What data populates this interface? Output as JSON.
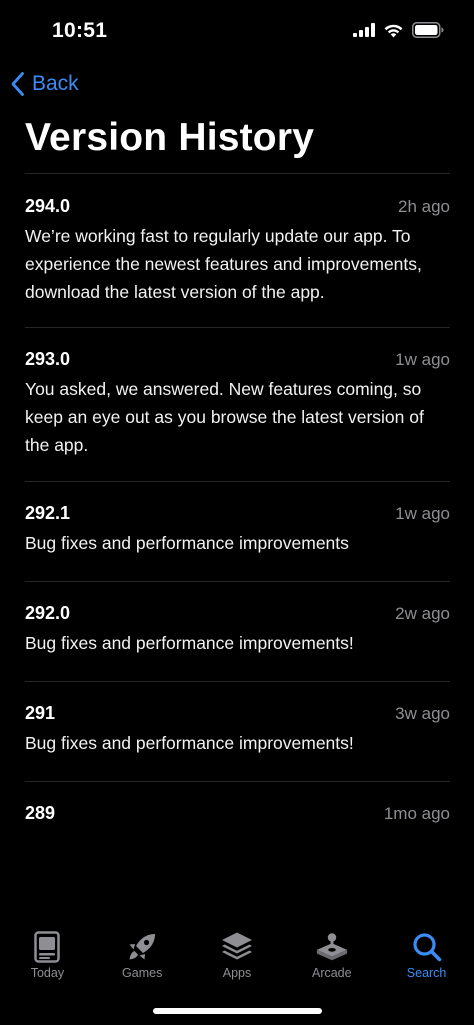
{
  "status_bar": {
    "time": "10:51"
  },
  "nav": {
    "back_label": "Back",
    "title": "Version History"
  },
  "versions": [
    {
      "number": "294.0",
      "date": "2h ago",
      "notes": "We’re working fast to regularly update our app. To experience the newest features and improvements, download the latest version of the app."
    },
    {
      "number": "293.0",
      "date": "1w ago",
      "notes": "You asked, we answered. New features coming, so keep an eye out as you browse the latest version of the app."
    },
    {
      "number": "292.1",
      "date": "1w ago",
      "notes": "Bug fixes and performance improvements"
    },
    {
      "number": "292.0",
      "date": "2w ago",
      "notes": "Bug fixes and performance improvements!"
    },
    {
      "number": "291",
      "date": "3w ago",
      "notes": "Bug fixes and performance improvements!"
    },
    {
      "number": "289",
      "date": "1mo ago",
      "notes": ""
    }
  ],
  "tab_bar": {
    "tabs": [
      {
        "label": "Today",
        "icon": "today-icon",
        "active": false
      },
      {
        "label": "Games",
        "icon": "rocket-icon",
        "active": false
      },
      {
        "label": "Apps",
        "icon": "apps-stack-icon",
        "active": false
      },
      {
        "label": "Arcade",
        "icon": "joystick-icon",
        "active": false
      },
      {
        "label": "Search",
        "icon": "search-icon",
        "active": true
      }
    ]
  },
  "colors": {
    "accent": "#3b8cf6",
    "background": "#000000",
    "secondary_text": "#8e8e93",
    "separator": "#262626"
  }
}
